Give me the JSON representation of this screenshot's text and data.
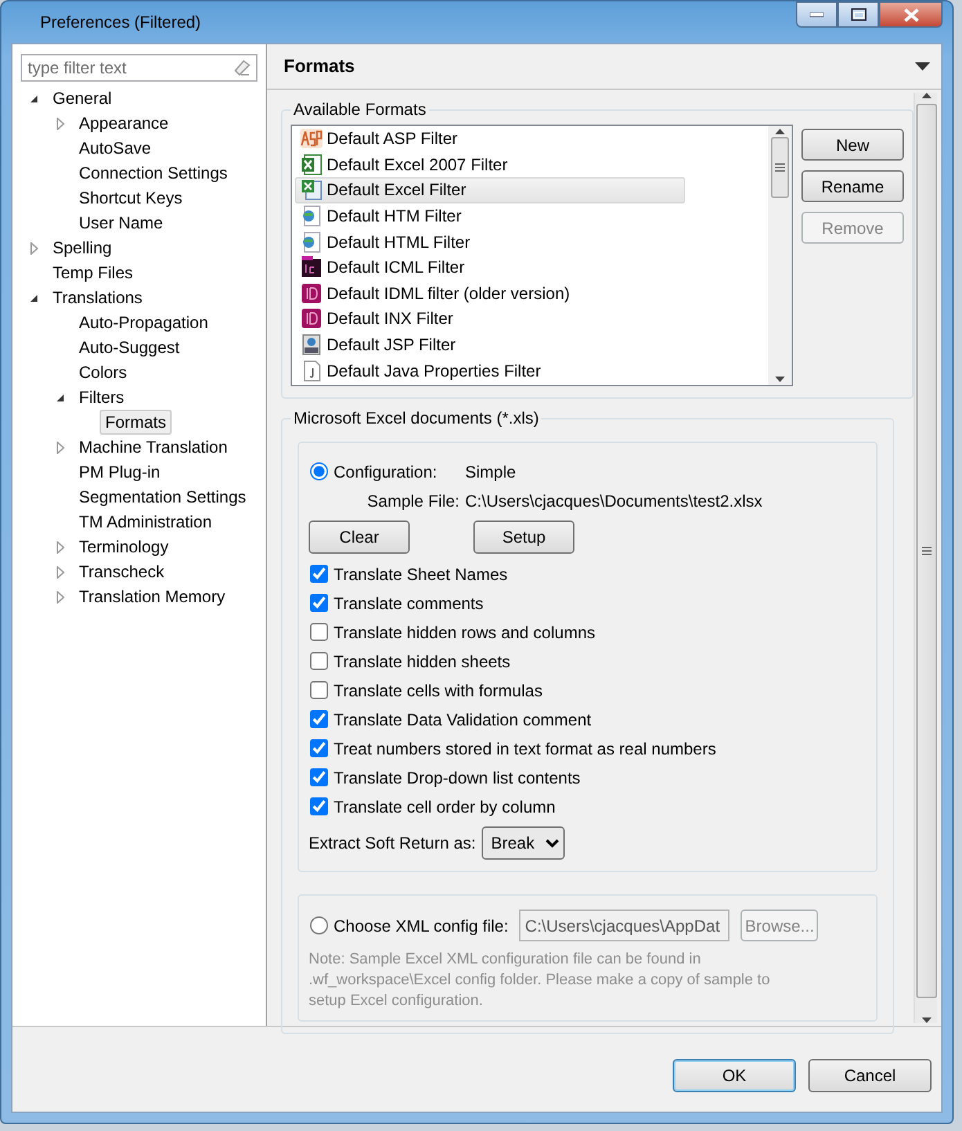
{
  "window": {
    "title": "Preferences (Filtered)"
  },
  "filter": {
    "placeholder": "type filter text"
  },
  "tree": [
    {
      "label": "General",
      "expanded": true,
      "selected": false,
      "children": [
        {
          "label": "Appearance",
          "expanded": false,
          "selected": false
        },
        {
          "label": "AutoSave",
          "selected": false
        },
        {
          "label": "Connection Settings",
          "selected": false
        },
        {
          "label": "Shortcut Keys",
          "selected": false
        },
        {
          "label": "User Name",
          "selected": false
        }
      ]
    },
    {
      "label": "Spelling",
      "expanded": false,
      "selected": false
    },
    {
      "label": "Temp Files",
      "selected": false
    },
    {
      "label": "Translations",
      "expanded": true,
      "selected": false,
      "children": [
        {
          "label": "Auto-Propagation",
          "selected": false
        },
        {
          "label": "Auto-Suggest",
          "selected": false
        },
        {
          "label": "Colors",
          "selected": false
        },
        {
          "label": "Filters",
          "expanded": true,
          "selected": false,
          "children": [
            {
              "label": "Formats",
              "selected": true
            }
          ]
        },
        {
          "label": "Machine Translation",
          "expanded": false,
          "selected": false
        },
        {
          "label": "PM Plug-in",
          "selected": false
        },
        {
          "label": "Segmentation Settings",
          "selected": false
        },
        {
          "label": "TM Administration",
          "selected": false
        },
        {
          "label": "Terminology",
          "expanded": false,
          "selected": false
        },
        {
          "label": "Transcheck",
          "expanded": false,
          "selected": false
        },
        {
          "label": "Translation Memory",
          "expanded": false,
          "selected": false
        }
      ]
    }
  ],
  "page": {
    "title": "Formats"
  },
  "available_formats": {
    "label": "Available Formats",
    "items": [
      {
        "label": "Default ASP Filter",
        "kind": "asp",
        "selected": false
      },
      {
        "label": "Default Excel 2007 Filter",
        "kind": "excel2007",
        "selected": false
      },
      {
        "label": "Default Excel Filter",
        "kind": "excel",
        "selected": true
      },
      {
        "label": "Default HTM Filter",
        "kind": "web",
        "selected": false
      },
      {
        "label": "Default HTML Filter",
        "kind": "web",
        "selected": false
      },
      {
        "label": "Default ICML Filter",
        "kind": "incopy",
        "selected": false
      },
      {
        "label": "Default IDML filter (older version)",
        "kind": "indesign",
        "selected": false
      },
      {
        "label": "Default INX Filter",
        "kind": "indesign",
        "selected": false
      },
      {
        "label": "Default JSP Filter",
        "kind": "jsp",
        "selected": false
      },
      {
        "label": "Default Java Properties Filter",
        "kind": "java",
        "selected": false
      }
    ],
    "buttons": [
      {
        "label": "New",
        "disabled": false
      },
      {
        "label": "Rename",
        "disabled": false
      },
      {
        "label": "Remove",
        "disabled": true
      }
    ]
  },
  "excel_group": {
    "label": "Microsoft Excel documents (*.xls)",
    "configuration": {
      "label": "Configuration:",
      "value": "Simple",
      "selected": true
    },
    "sample_file": {
      "label": "Sample File:",
      "value": "C:\\Users\\cjacques\\Documents\\test2.xlsx"
    },
    "buttons": [
      {
        "label": "Clear"
      },
      {
        "label": "Setup"
      }
    ],
    "options": [
      {
        "label": "Translate Sheet Names",
        "checked": true
      },
      {
        "label": "Translate comments",
        "checked": true
      },
      {
        "label": "Translate hidden rows and columns",
        "checked": false
      },
      {
        "label": "Translate hidden sheets",
        "checked": false
      },
      {
        "label": "Translate cells with formulas",
        "checked": false
      },
      {
        "label": "Translate Data Validation comment",
        "checked": true
      },
      {
        "label": "Treat numbers stored in text format as real numbers",
        "checked": true
      },
      {
        "label": "Translate Drop-down list contents",
        "checked": true
      },
      {
        "label": "Translate cell order by column",
        "checked": true
      }
    ],
    "soft_return": {
      "label": "Extract Soft Return as:",
      "value": "Break"
    },
    "xml_config": {
      "label": "Choose XML config file:",
      "selected": false,
      "value": "C:\\Users\\cjacques\\AppDat",
      "button": "Browse...",
      "note": "Note: Sample Excel XML configuration file can be found in .wf_workspace\\Excel config folder. Please make a copy of sample to setup Excel configuration."
    }
  },
  "footer": {
    "buttons": [
      "OK",
      "Cancel"
    ]
  }
}
